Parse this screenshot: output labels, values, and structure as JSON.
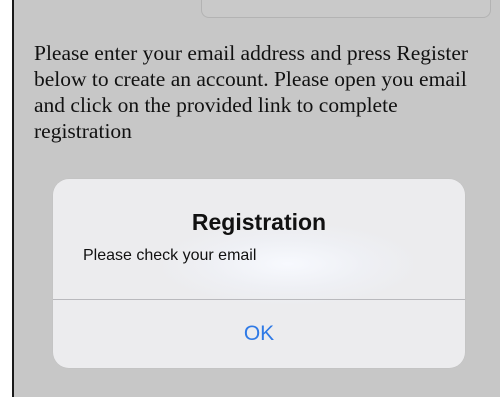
{
  "page": {
    "instructions": "Please enter your email address and press Register below to create an account. Please open you email and click on the provided link to complete registration"
  },
  "alert": {
    "title": "Registration",
    "message": "Please check your email",
    "ok_label": "OK"
  },
  "colors": {
    "background": "#c7c7c7",
    "alert_background": "#ededf0",
    "button_blue": "#2f7ae6",
    "text": "#111111"
  }
}
